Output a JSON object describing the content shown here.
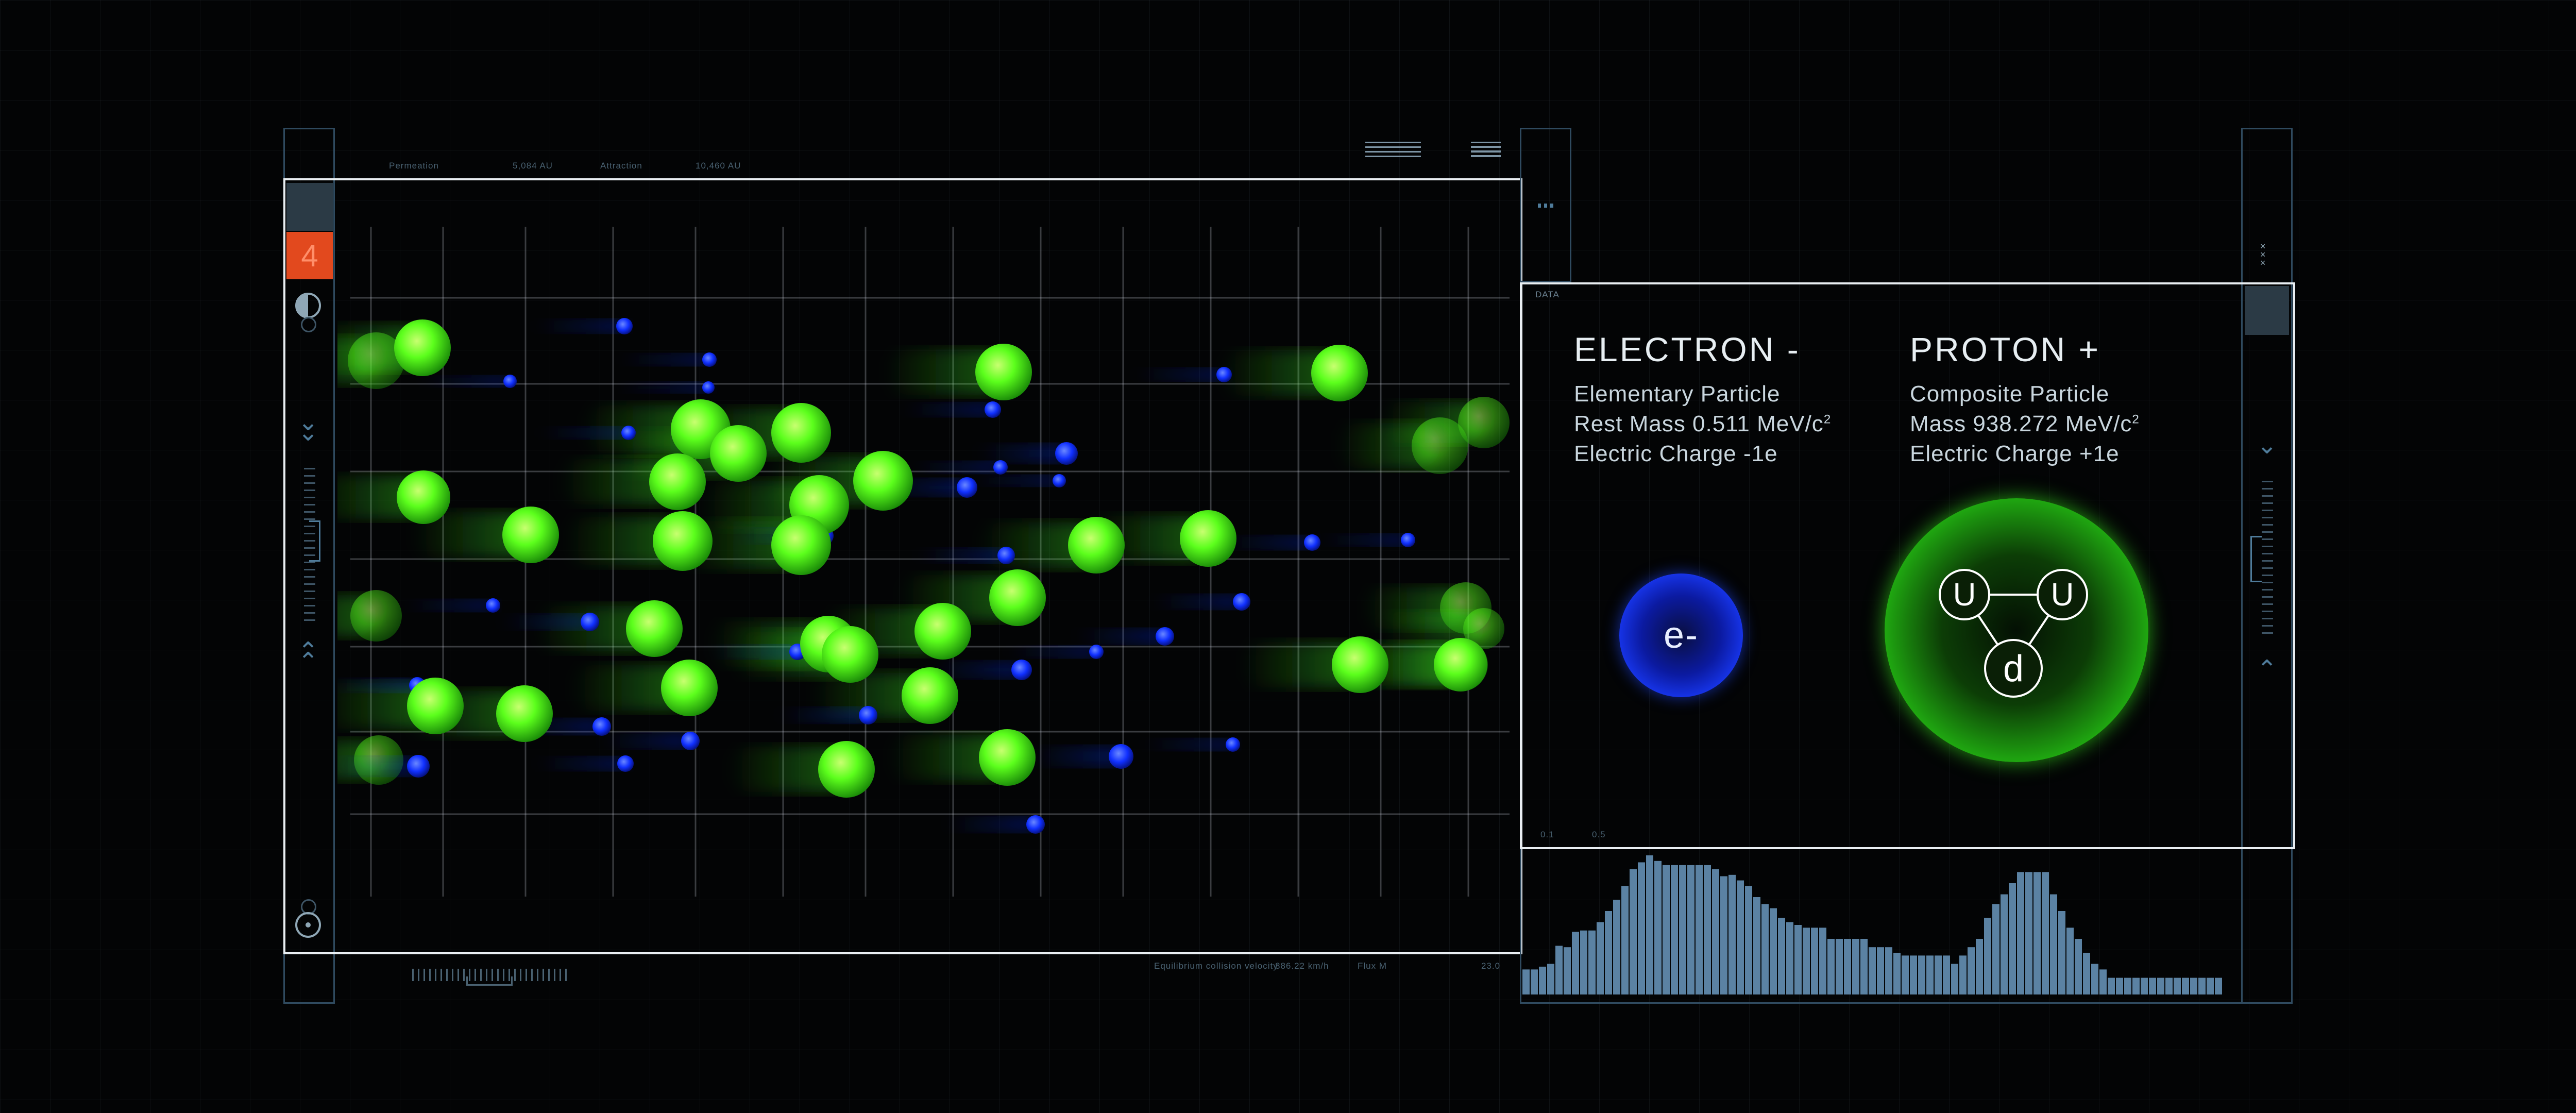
{
  "top_meta": {
    "label_a": "Permeation",
    "value_a": "5,084 AU",
    "label_b": "Attraction",
    "value_b": "10,460 AU"
  },
  "bottom_meta": {
    "velocity_label": "Equilibrium collision velocity",
    "velocity_value": "886.22 km/h",
    "flux_label": "Flux M",
    "flux_value": "23.0"
  },
  "sidebar_left": {
    "badge": "4"
  },
  "data_panel": {
    "header": "DATA",
    "axis_ticks": [
      "0.1",
      "0.5"
    ],
    "electron": {
      "title": "ELECTRON -",
      "line1": "Elementary Particle",
      "line2_prefix": "Rest Mass 0.511 MeV/c",
      "line2_sup": "2",
      "line3": "Electric Charge -1e",
      "symbol": "e-"
    },
    "proton": {
      "title": "PROTON +",
      "line1": "Composite Particle",
      "line2_prefix": "Mass 938.272 MeV/c",
      "line2_sup": "2",
      "line3": "Electric Charge +1e",
      "quarks": [
        "U",
        "U",
        "d"
      ]
    }
  },
  "colors": {
    "proton_green": "#3cff1e",
    "electron_blue": "#1030ff",
    "frame_blue": "#2f4a5f",
    "badge_orange": "#e2491e",
    "bar_blue": "#5b82a3"
  },
  "icons": [
    "half-circle-icon",
    "chevron-down-icon",
    "chevron-up-icon",
    "target-icon",
    "close-icon",
    "menu-icon"
  ],
  "simulation": {
    "protons": [
      [
        155,
        256
      ],
      [
        172,
        288
      ],
      [
        258,
        228
      ],
      [
        376,
        242
      ],
      [
        362,
        230
      ],
      [
        441,
        240
      ],
      [
        330,
        321
      ],
      [
        482,
        319
      ],
      [
        480,
        338
      ],
      [
        479,
        308
      ],
      [
        396,
        330
      ],
      [
        396,
        372
      ],
      [
        513,
        347
      ],
      [
        564,
        346
      ],
      [
        599,
        358
      ],
      [
        614,
        406
      ],
      [
        596,
        449
      ],
      [
        611,
        500
      ],
      [
        713,
        370
      ],
      [
        726,
        390
      ],
      [
        712,
        353
      ],
      [
        689,
        359
      ],
      [
        773,
        396
      ],
      [
        892,
        280
      ],
      [
        1217,
        323
      ],
      [
        1349,
        289
      ],
      [
        1437,
        292
      ],
      [
        922,
        513
      ],
      [
        941,
        478
      ],
      [
        778,
        514
      ],
      [
        776,
        514
      ],
      [
        744,
        533
      ],
      [
        751,
        485
      ],
      [
        825,
        542
      ],
      [
        879,
        560
      ],
      [
        814,
        604
      ],
      [
        801,
        575
      ],
      [
        1066,
        492
      ],
      [
        1124,
        503
      ],
      [
        1151,
        526
      ],
      [
        1225,
        509
      ],
      [
        1383,
        523
      ],
      [
        1383,
        513
      ],
      [
        1417,
        455
      ],
      [
        1541,
        414
      ],
      [
        1577,
        400
      ],
      [
        1548,
        486
      ],
      [
        1577,
        498
      ],
      [
        1601,
        479
      ],
      [
        1606,
        507
      ],
      [
        1688,
        499
      ],
      [
        1717,
        472
      ],
      [
        1723,
        467
      ],
      [
        1810,
        446
      ],
      [
        1891,
        485
      ],
      [
        2134,
        475
      ],
      [
        2136,
        493
      ],
      [
        2176,
        472
      ],
      [
        2190,
        473
      ],
      [
        2213,
        468
      ],
      [
        2256,
        460
      ],
      [
        2376,
        473
      ],
      [
        2387,
        461
      ],
      [
        2456,
        480
      ],
      [
        2538,
        471
      ],
      [
        2693,
        486
      ],
      [
        2753,
        475
      ],
      [
        2795,
        538
      ],
      [
        2900,
        473
      ],
      [
        2911,
        473
      ],
      [
        2902,
        480
      ],
      [
        2896,
        474
      ]
    ],
    "proton_list": [
      [
        820,
        675,
        55
      ],
      [
        1948,
        722,
        55
      ],
      [
        2600,
        724,
        55
      ],
      [
        1360,
        833,
        58
      ],
      [
        1555,
        840,
        58
      ],
      [
        1433,
        880,
        55
      ],
      [
        1714,
        933,
        58
      ],
      [
        1315,
        935,
        55
      ],
      [
        1590,
        980,
        58
      ],
      [
        822,
        965,
        52
      ],
      [
        1030,
        1038,
        55
      ],
      [
        1325,
        1050,
        58
      ],
      [
        1555,
        1058,
        58
      ],
      [
        2128,
        1058,
        55
      ],
      [
        2345,
        1045,
        55
      ],
      [
        1975,
        1160,
        55
      ],
      [
        1270,
        1220,
        55
      ],
      [
        1830,
        1225,
        55
      ],
      [
        1608,
        1250,
        55
      ],
      [
        1650,
        1270,
        55
      ],
      [
        2640,
        1290,
        55
      ],
      [
        1338,
        1335,
        55
      ],
      [
        1018,
        1385,
        55
      ],
      [
        1805,
        1350,
        55
      ],
      [
        845,
        1370,
        55
      ],
      [
        1955,
        1470,
        55
      ],
      [
        1643,
        1493,
        55
      ],
      [
        2835,
        1290,
        52
      ]
    ],
    "proton_faint": [
      [
        730,
        700,
        55
      ],
      [
        730,
        1195,
        50
      ],
      [
        735,
        1475,
        48
      ],
      [
        2795,
        865,
        55
      ],
      [
        2880,
        820,
        50
      ],
      [
        2845,
        1180,
        50
      ],
      [
        2838,
        1290,
        50
      ],
      [
        2880,
        1220,
        40
      ]
    ],
    "electron_list": [
      [
        1212,
        633,
        16
      ],
      [
        1377,
        698,
        14
      ],
      [
        990,
        740,
        13
      ],
      [
        1375,
        752,
        12
      ],
      [
        1927,
        795,
        16
      ],
      [
        2376,
        727,
        15
      ],
      [
        1220,
        840,
        14
      ],
      [
        2070,
        880,
        22
      ],
      [
        1942,
        907,
        14
      ],
      [
        2056,
        933,
        13
      ],
      [
        1877,
        946,
        20
      ],
      [
        1600,
        1040,
        18
      ],
      [
        1953,
        1078,
        17
      ],
      [
        2547,
        1053,
        16
      ],
      [
        2733,
        1048,
        14
      ],
      [
        957,
        1175,
        14
      ],
      [
        1145,
        1207,
        18
      ],
      [
        2410,
        1168,
        17
      ],
      [
        2261,
        1235,
        18
      ],
      [
        1548,
        1265,
        16
      ],
      [
        2128,
        1265,
        14
      ],
      [
        1983,
        1300,
        20
      ],
      [
        810,
        1330,
        16
      ],
      [
        1685,
        1388,
        18
      ],
      [
        1168,
        1410,
        18
      ],
      [
        1340,
        1438,
        18
      ],
      [
        2393,
        1445,
        14
      ],
      [
        2176,
        1468,
        24
      ],
      [
        812,
        1487,
        22
      ],
      [
        1214,
        1482,
        16
      ],
      [
        2010,
        1600,
        18
      ]
    ]
  },
  "histogram": {
    "values": [
      0.18,
      0.18,
      0.2,
      0.22,
      0.35,
      0.34,
      0.45,
      0.46,
      0.46,
      0.52,
      0.6,
      0.68,
      0.78,
      0.9,
      0.95,
      1.0,
      0.96,
      0.93,
      0.93,
      0.93,
      0.93,
      0.93,
      0.93,
      0.9,
      0.85,
      0.86,
      0.82,
      0.78,
      0.7,
      0.65,
      0.62,
      0.55,
      0.52,
      0.5,
      0.48,
      0.48,
      0.48,
      0.4,
      0.4,
      0.4,
      0.4,
      0.4,
      0.34,
      0.34,
      0.34,
      0.3,
      0.28,
      0.28,
      0.28,
      0.28,
      0.28,
      0.28,
      0.22,
      0.28,
      0.34,
      0.4,
      0.55,
      0.65,
      0.72,
      0.8,
      0.88,
      0.88,
      0.88,
      0.88,
      0.72,
      0.6,
      0.48,
      0.4,
      0.3,
      0.22,
      0.18,
      0.12,
      0.12,
      0.12,
      0.12,
      0.12,
      0.12,
      0.12,
      0.12,
      0.12,
      0.12,
      0.12,
      0.12,
      0.12,
      0.12
    ]
  }
}
